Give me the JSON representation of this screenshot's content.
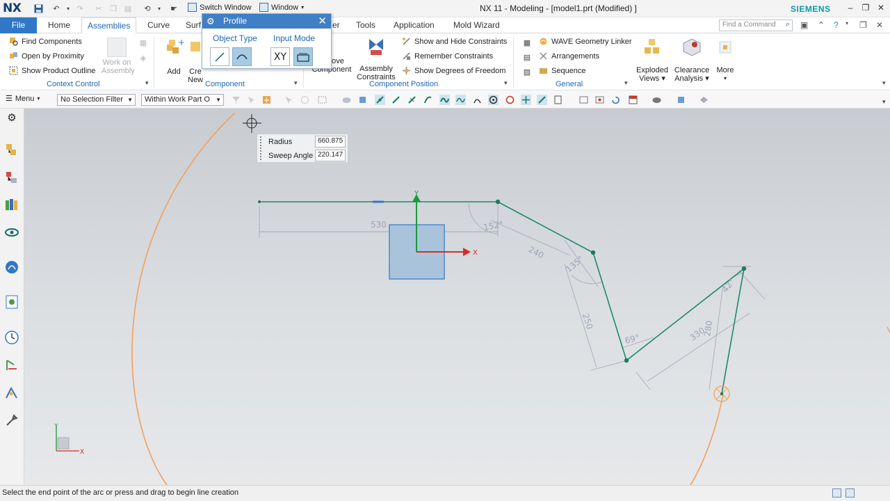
{
  "titlebar": {
    "logo": "NX",
    "switch_window": "Switch Window",
    "window_menu": "Window",
    "title": "NX 11 - Modeling - [model1.prt (Modified) ]",
    "brand": "SIEMENS"
  },
  "tabs": {
    "file": "File",
    "items": [
      "Home",
      "Assemblies",
      "Curve",
      "Surf",
      "er",
      "Tools",
      "Application",
      "Mold Wizard"
    ],
    "active": "Assemblies",
    "find_command_placeholder": "Find a Command"
  },
  "ribbon": {
    "context_control": {
      "label": "Context Control",
      "items": [
        "Find Components",
        "Open by Proximity",
        "Show Product Outline"
      ],
      "work_on_assembly": [
        "Work on",
        "Assembly"
      ]
    },
    "component": {
      "label": "Component",
      "add": "Add",
      "create_new": [
        "Cre",
        "New"
      ],
      "move_component": [
        "ove",
        "Component"
      ]
    },
    "component_position": {
      "label": "Component Position",
      "assembly_constraints": [
        "Assembly",
        "Constraints"
      ],
      "items": [
        "Show and Hide Constraints",
        "Remember Constraints",
        "Show Degrees of Freedom"
      ]
    },
    "general": {
      "label": "General",
      "items": [
        "WAVE Geometry Linker",
        "Arrangements",
        "Sequence"
      ],
      "exploded_views": [
        "Exploded",
        "Views ▾"
      ],
      "clearance_analysis": [
        "Clearance",
        "Analysis ▾"
      ],
      "more": "More"
    }
  },
  "selection_bar": {
    "menu": "Menu",
    "filter": "No Selection Filter",
    "scope": "Within Work Part O"
  },
  "profile_dialog": {
    "title": "Profile",
    "object_type_label": "Object Type",
    "input_mode_label": "Input Mode",
    "xy_label": "XY"
  },
  "dynamic_input": {
    "radius_label": "Radius",
    "radius_value": "660.875",
    "sweep_label": "Sweep Angle",
    "sweep_value": "220.147"
  },
  "sketch": {
    "dimensions": [
      "530",
      "152°",
      "240",
      "135°",
      "250",
      "69°",
      "330",
      "280",
      "42°"
    ],
    "axis_x": "X",
    "axis_y": "Y"
  },
  "status_bar": {
    "text": "Select the end point of the arc or press and drag to begin line creation"
  },
  "colors": {
    "accent": "#2f78c8",
    "brand": "#0a9aa9",
    "sketch_line": "#1a8a6a",
    "arc": "#f2a05a"
  }
}
